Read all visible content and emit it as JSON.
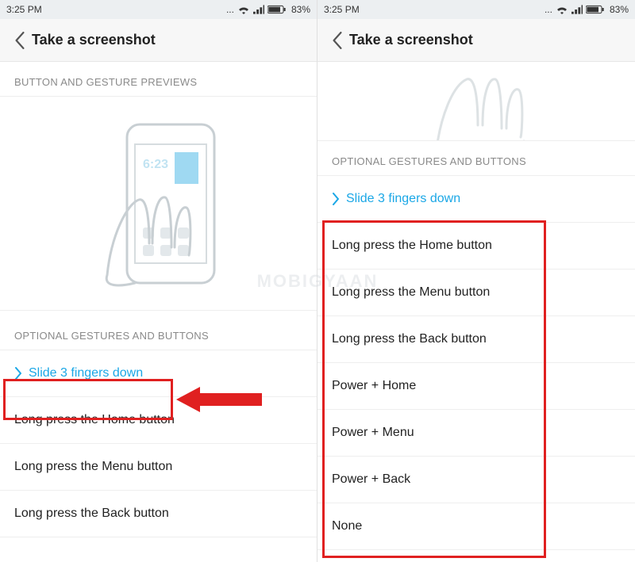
{
  "statusbar": {
    "time": "3:25 PM",
    "battery_pct": "83%"
  },
  "header": {
    "title": "Take a screenshot"
  },
  "sections": {
    "preview_label": "BUTTON AND GESTURE PREVIEWS",
    "optional_label": "OPTIONAL GESTURES AND BUTTONS"
  },
  "options": {
    "selected": "Slide 3 fingers down",
    "list": {
      "0": "Long press the Home button",
      "1": "Long press the Menu button",
      "2": "Long press the Back button",
      "3": "Power + Home",
      "4": "Power + Menu",
      "5": "Power + Back",
      "6": "None"
    }
  },
  "watermark": "MOBIGYAAN",
  "preview_clock": "6:23"
}
